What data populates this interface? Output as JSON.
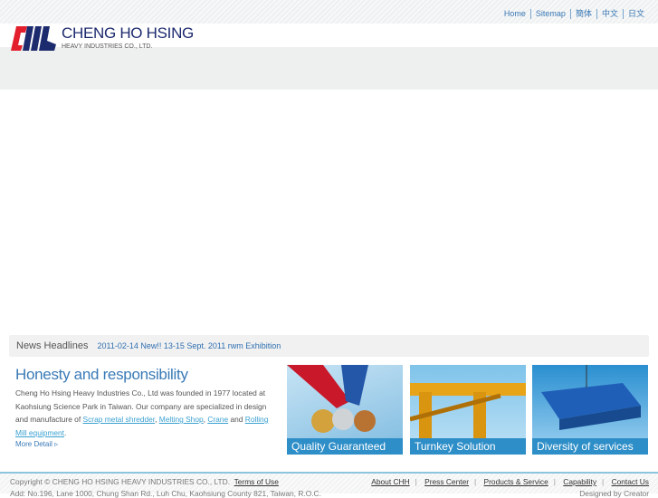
{
  "top_links": [
    "Home",
    "Sitemap",
    "簡体",
    "中文",
    "日文"
  ],
  "brand": {
    "name": "CHENG HO HSING",
    "sub": "HEAVY INDUSTRIES CO., LTD."
  },
  "news": {
    "heading": "News Headlines",
    "item": "2011-02-14 New!! 13-15 Sept. 2011 rwm Exhibition"
  },
  "about": {
    "title": "Honesty and responsibility",
    "text1": "Cheng Ho Hsing Heavy Industries Co., Ltd was founded in 1977 located at Kaohsiung Science Park in Taiwan. Our company are specialized in design and manufacture of ",
    "link1": "Scrap metal shredder",
    "link2": "Melting Shop",
    "link3": "Crane",
    "and": " and ",
    "link4": "Rolling Mill equipment",
    "more": "More Detail ▹"
  },
  "features": [
    "Quality Guaranteed",
    "Turnkey Solution",
    "Diversity of services"
  ],
  "footer": {
    "copyright": "Copyright © CHENG HO HSING HEAVY INDUSTRIES CO., LTD.",
    "terms": "Terms of Use",
    "links": [
      "About CHH",
      "Press Center",
      "Products & Service",
      "Capability",
      "Contact Us"
    ],
    "address": "Add: No.196, Lane 1000, Chung Shan Rd., Luh Chu, Kaohsiung County 821, Taiwan, R.O.C.",
    "designed": "Designed by Creator"
  }
}
